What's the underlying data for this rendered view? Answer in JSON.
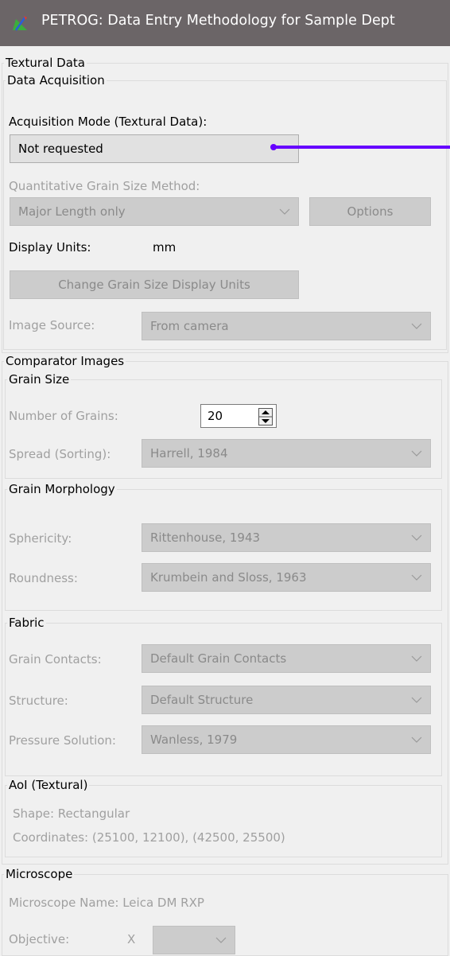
{
  "window": {
    "title": "PETROG: Data Entry Methodology for Sample Dept"
  },
  "textural": {
    "legend": "Textural Data",
    "acquisition": {
      "legend": "Data Acquisition",
      "mode_label": "Acquisition Mode (Textural Data):",
      "mode_value": "Not requested",
      "quant_label": "Quantitative Grain Size Method:",
      "quant_value": "Major Length only",
      "options_label": "Options",
      "display_units_label": "Display Units:",
      "display_units_value": "mm",
      "change_units_label": "Change Grain Size Display Units",
      "image_source_label": "Image Source:",
      "image_source_value": "From camera"
    }
  },
  "comparator": {
    "legend": "Comparator Images",
    "grain_size": {
      "legend": "Grain Size",
      "num_grains_label": "Number of Grains:",
      "num_grains_value": "20",
      "spread_label": "Spread (Sorting):",
      "spread_value": "Harrell, 1984"
    },
    "morphology": {
      "legend": "Grain Morphology",
      "sphericity_label": "Sphericity:",
      "sphericity_value": "Rittenhouse, 1943",
      "roundness_label": "Roundness:",
      "roundness_value": "Krumbein and Sloss, 1963"
    },
    "fabric": {
      "legend": "Fabric",
      "contacts_label": "Grain Contacts:",
      "contacts_value": "Default Grain Contacts",
      "structure_label": "Structure:",
      "structure_value": "Default Structure",
      "pressure_label": "Pressure Solution:",
      "pressure_value": "Wanless, 1979"
    },
    "aoi": {
      "legend": "AoI (Textural)",
      "shape_text": "Shape: Rectangular",
      "coords_text": "Coordinates: (25100, 12100), (42500, 25500)"
    }
  },
  "microscope": {
    "legend": "Microscope",
    "name_text": "Microscope Name:  Leica DM RXP",
    "objective_label": "Objective:",
    "objective_x": "X"
  },
  "colors": {
    "titlebar": "#6b6567",
    "annotation_arrow": "#6600ff",
    "panel": "#f0f0f0"
  }
}
